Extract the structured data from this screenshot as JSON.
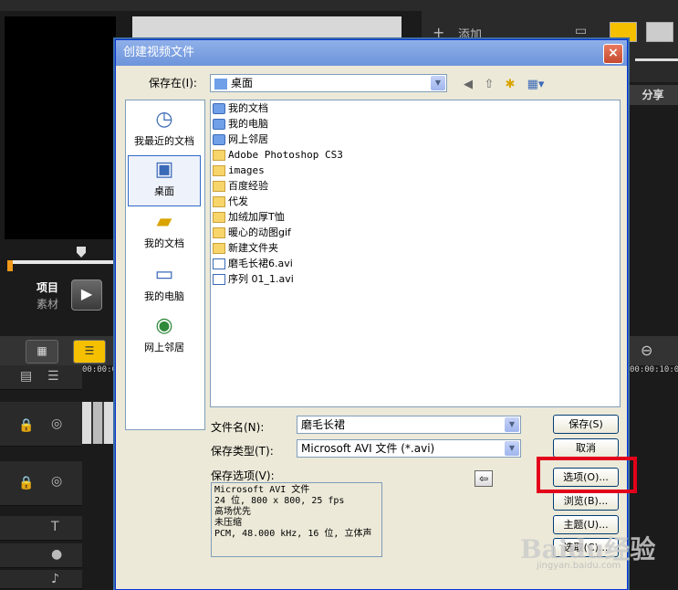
{
  "background_app": {
    "mode_labels": [
      "项目",
      "素材"
    ],
    "add_label": "添加",
    "share_tab": "分享",
    "timecode_left": "00:00:0",
    "timecode_right": "00:00:10:0"
  },
  "dialog": {
    "title": "创建视频文件",
    "save_in_label": "保存在(I):",
    "save_in_value": "桌面",
    "places": [
      "我最近的文档",
      "桌面",
      "我的文档",
      "我的电脑",
      "网上邻居"
    ],
    "files": [
      {
        "name": "我的文档",
        "type": "special"
      },
      {
        "name": "我的电脑",
        "type": "special"
      },
      {
        "name": "网上邻居",
        "type": "special"
      },
      {
        "name": "Adobe Photoshop CS3",
        "type": "folder"
      },
      {
        "name": "images",
        "type": "folder"
      },
      {
        "name": "百度经验",
        "type": "folder"
      },
      {
        "name": "代发",
        "type": "folder"
      },
      {
        "name": "加绒加厚T恤",
        "type": "folder"
      },
      {
        "name": "暖心的动图gif",
        "type": "folder"
      },
      {
        "name": "新建文件夹",
        "type": "folder"
      },
      {
        "name": "磨毛长裙6.avi",
        "type": "avi"
      },
      {
        "name": "序列 01_1.avi",
        "type": "avi"
      }
    ],
    "filename_label": "文件名(N):",
    "filename_value": "磨毛长裙",
    "filetype_label": "保存类型(T):",
    "filetype_value": "Microsoft AVI 文件 (*.avi)",
    "options_label": "保存选项(V):",
    "options_lines": [
      "Microsoft AVI 文件",
      "24 位, 800 x 800, 25 fps",
      "高场优先",
      "未压缩",
      "PCM, 48.000 kHz, 16 位, 立体声"
    ],
    "buttons": {
      "save": "保存(S)",
      "cancel": "取消",
      "options": "选项(O)...",
      "browse": "浏览(B)...",
      "theme": "主题(U)...",
      "extra": "选取(C)..."
    }
  },
  "watermark": {
    "brand": "Baidu经验",
    "url": "jingyan.baidu.com"
  },
  "colors": {
    "highlight": "#e3001b",
    "accent_yellow": "#f5c000",
    "dialog_bg": "#ece9d8"
  }
}
